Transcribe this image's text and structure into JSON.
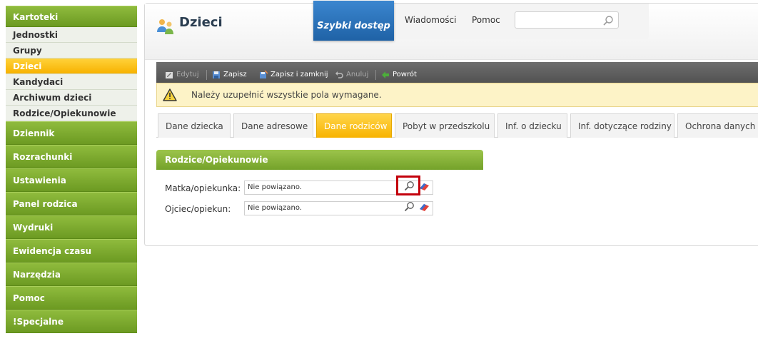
{
  "sidebar": {
    "kartoteki": "Kartoteki",
    "sub": [
      "Jednostki",
      "Grupy",
      "Dzieci",
      "Kandydaci",
      "Archiwum dzieci",
      "Rodzice/Opiekunowie"
    ],
    "sections": [
      "Dziennik",
      "Rozrachunki",
      "Ustawienia",
      "Panel rodzica",
      "Wydruki",
      "Ewidencja czasu",
      "Narzędzia",
      "Pomoc",
      "!Specjalne"
    ]
  },
  "header": {
    "title": "Dzieci",
    "page_icon": "people-icon",
    "quick_access": "Szybki dostęp",
    "links": [
      "Wiadomości",
      "Pomoc"
    ],
    "search_placeholder": "",
    "search_icon": "search-icon"
  },
  "toolbar": {
    "edit": "Edytuj",
    "save": "Zapisz",
    "save_close": "Zapisz i zamknij",
    "cancel": "Anuluj",
    "back": "Powrót"
  },
  "warning": {
    "text": "Należy uzupełnić wszystkie pola wymagane.",
    "icon": "warning-icon"
  },
  "tabs": [
    "Dane dziecka",
    "Dane adresowe",
    "Dane rodziców",
    "Pobyt w przedszkolu",
    "Inf. o dziecku",
    "Inf. dotyczące rodziny",
    "Ochrona danych"
  ],
  "active_tab": "Dane rodziców",
  "section": {
    "title": "Rodzice/Opiekunowie",
    "fields": [
      {
        "label": "Matka/opiekunka:",
        "value": "Nie powiązano."
      },
      {
        "label": "Ojciec/opiekun:",
        "value": "Nie powiązano."
      }
    ]
  },
  "colors": {
    "sidebar_green": "#7aa52c",
    "active_yellow": "#f8b300",
    "quick_blue": "#2a70b8",
    "highlight_red": "#c3000c"
  }
}
